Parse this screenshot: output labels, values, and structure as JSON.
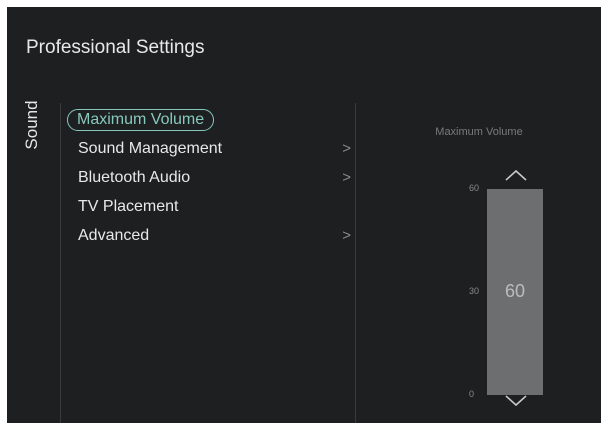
{
  "page_title": "Professional Settings",
  "section_label": "Sound",
  "menu": [
    {
      "label": "Maximum Volume",
      "selected": true,
      "has_submenu": false
    },
    {
      "label": "Sound Management",
      "selected": false,
      "has_submenu": true
    },
    {
      "label": "Bluetooth Audio",
      "selected": false,
      "has_submenu": true
    },
    {
      "label": "TV Placement",
      "selected": false,
      "has_submenu": false
    },
    {
      "label": "Advanced",
      "selected": false,
      "has_submenu": true
    }
  ],
  "chevron_glyph": ">",
  "slider": {
    "title": "Maximum Volume",
    "max_label": "60",
    "mid_label": "30",
    "min_label": "0",
    "value_text": "60",
    "value": 60,
    "max": 60,
    "min": 0
  },
  "colors": {
    "background": "#1e1f21",
    "accent": "#86c9bc",
    "text": "#e8e8e8",
    "slider_fill": "#6d6e70"
  }
}
